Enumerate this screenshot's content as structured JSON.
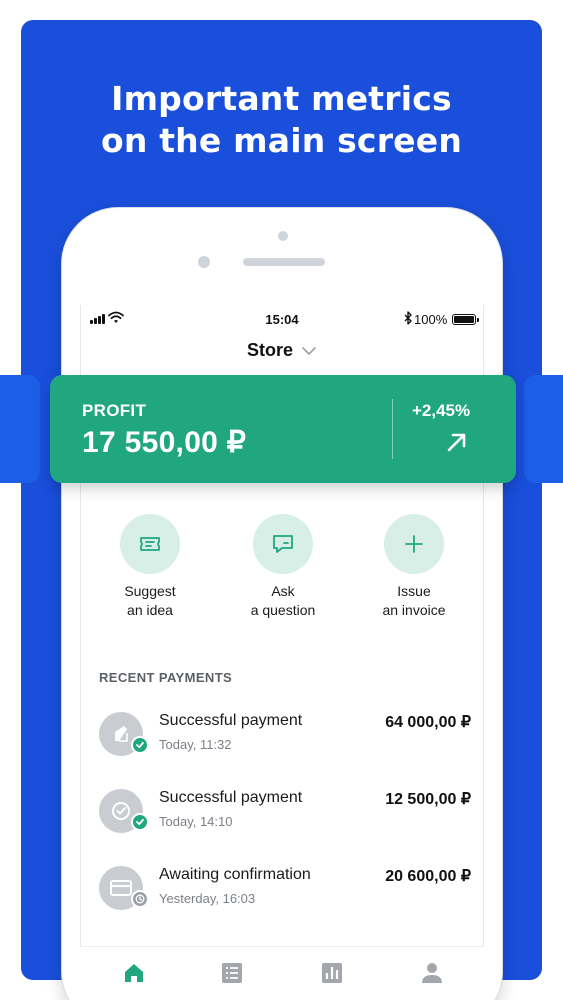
{
  "promo": {
    "headline_line1": "Important metrics",
    "headline_line2": "on the main screen"
  },
  "status_bar": {
    "time": "15:04",
    "battery": "100%"
  },
  "header": {
    "store_label": "Store"
  },
  "profit_card": {
    "label": "PROFIT",
    "value": "17 550,00 ₽",
    "change": "+2,45%"
  },
  "actions": [
    {
      "label_line1": "Suggest",
      "label_line2": "an idea",
      "icon": "ticket-icon"
    },
    {
      "label_line1": "Ask",
      "label_line2": "a question",
      "icon": "chat-icon"
    },
    {
      "label_line1": "Issue",
      "label_line2": "an invoice",
      "icon": "plus-icon"
    }
  ],
  "recent_payments": {
    "title": "RECENT PAYMENTS",
    "items": [
      {
        "title": "Successful payment",
        "time": "Today, 11:32",
        "amount": "64 000,00 ₽",
        "status": "success"
      },
      {
        "title": "Successful payment",
        "time": "Today, 14:10",
        "amount": "12 500,00 ₽",
        "status": "success"
      },
      {
        "title": "Awaiting confirmation",
        "time": "Yesterday, 16:03",
        "amount": "20 600,00 ₽",
        "status": "pending"
      }
    ]
  },
  "tab_bar": {
    "tabs": [
      "home-icon",
      "list-icon",
      "chart-icon",
      "profile-icon"
    ],
    "active_tab": "home-icon"
  },
  "colors": {
    "brand_blue": "#1a4fdc",
    "profit_green": "#20a77f",
    "success_green": "#20a77f",
    "pending_gray": "#9aa0a8",
    "active_tab": "#20a77f",
    "inactive_tab": "#a3a7ad"
  }
}
